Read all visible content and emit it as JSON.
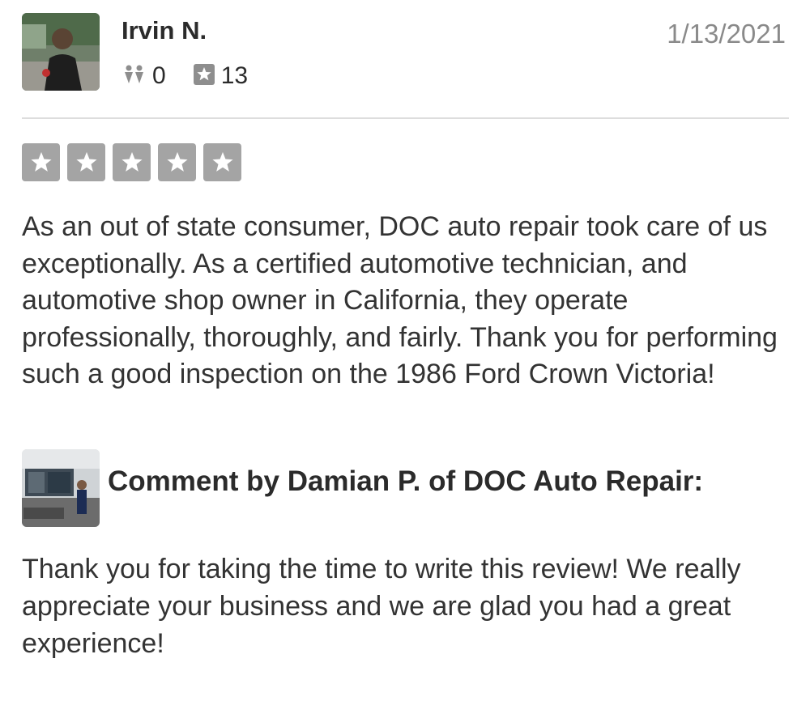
{
  "review": {
    "reviewer_name": "Irvin N.",
    "date": "1/13/2021",
    "friends_count": "0",
    "reviews_count": "13",
    "rating": 5,
    "max_rating": 5,
    "star_color": "#a4a4a4",
    "text": "As an out of state consumer, DOC auto repair took care of us exceptionally. As a certified automotive technician, and automotive shop owner in California, they operate professionally, thoroughly, and fairly. Thank you for performing such a good inspection on the 1986 Ford Crown Victoria!"
  },
  "owner_comment": {
    "heading": "Comment by Damian P. of DOC Auto Repair:",
    "text": "Thank you for taking the time to write this review! We really appreciate your business and we are glad you had a great experience!"
  },
  "icons": {
    "friends": "friends-icon",
    "reviews": "star-review-icon"
  }
}
